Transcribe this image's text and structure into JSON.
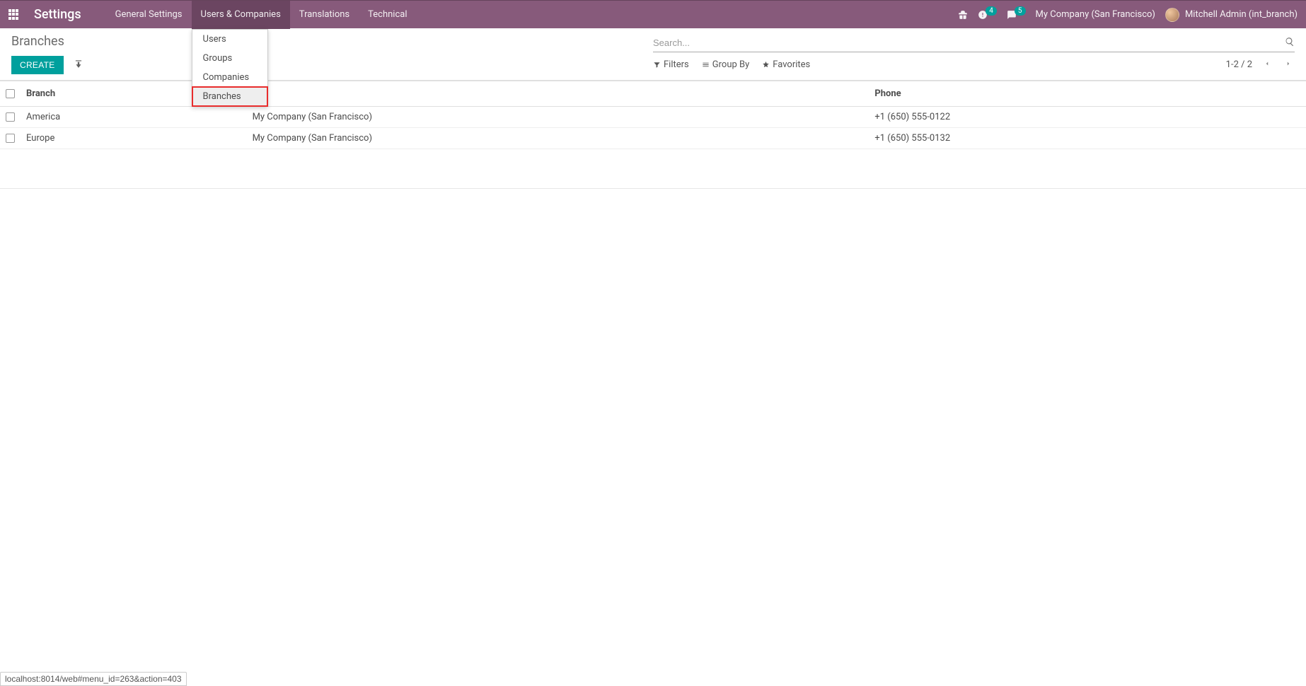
{
  "app": {
    "title": "Settings"
  },
  "nav": {
    "items": [
      {
        "label": "General Settings"
      },
      {
        "label": "Users & Companies"
      },
      {
        "label": "Translations"
      },
      {
        "label": "Technical"
      }
    ],
    "dropdown": {
      "users": "Users",
      "groups": "Groups",
      "companies": "Companies",
      "branches": "Branches"
    }
  },
  "header_right": {
    "badge1": "4",
    "badge2": "5",
    "company": "My Company (San Francisco)",
    "user": "Mitchell Admin (int_branch)"
  },
  "breadcrumb": "Branches",
  "buttons": {
    "create": "CREATE"
  },
  "search": {
    "placeholder": "Search..."
  },
  "toolbar": {
    "filters": "Filters",
    "group_by": "Group By",
    "favorites": "Favorites"
  },
  "pager": {
    "range": "1-2 / 2"
  },
  "table": {
    "headers": {
      "branch": "Branch",
      "phone": "Phone"
    },
    "rows": [
      {
        "branch": "America",
        "company": "My Company (San Francisco)",
        "phone": "+1 (650) 555-0122"
      },
      {
        "branch": "Europe",
        "company": "My Company (San Francisco)",
        "phone": "+1 (650) 555-0132"
      }
    ]
  },
  "status_url": "localhost:8014/web#menu_id=263&action=403"
}
